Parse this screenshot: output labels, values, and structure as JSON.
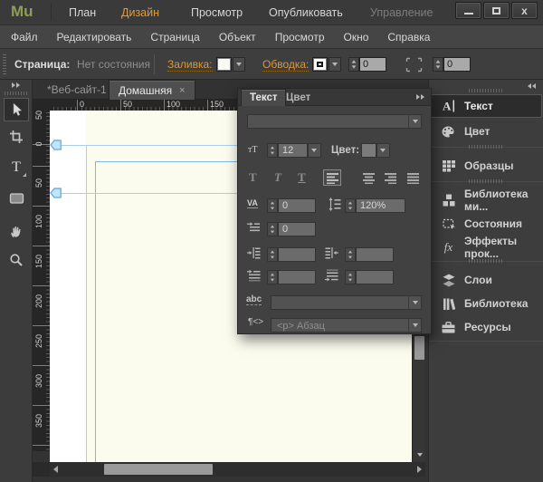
{
  "titlebar": {
    "logo": "Mu",
    "nav": [
      {
        "label": "План",
        "state": "normal"
      },
      {
        "label": "Дизайн",
        "state": "active"
      },
      {
        "label": "Просмотр",
        "state": "normal"
      },
      {
        "label": "Опубликовать",
        "state": "normal"
      },
      {
        "label": "Управление",
        "state": "disabled"
      }
    ],
    "close_glyph": "x"
  },
  "menubar": {
    "items": [
      "Файл",
      "Редактировать",
      "Страница",
      "Объект",
      "Просмотр",
      "Окно",
      "Справка"
    ]
  },
  "controlbar": {
    "page_label": "Страница:",
    "page_state": "Нет состояния",
    "fill_label": "Заливка:",
    "stroke_label": "Обводка:",
    "stroke_size": "0",
    "corner_radius": "0"
  },
  "tabbar": {
    "tabs": [
      {
        "label": "*Веб-сайт-1",
        "close": "×",
        "active": false
      },
      {
        "label": "Домашняя",
        "close": "×",
        "active": true
      }
    ]
  },
  "rulers": {
    "horizontal": [
      "0",
      "50",
      "100",
      "150"
    ],
    "vertical": [
      "50",
      "0",
      "50",
      "100",
      "150",
      "200",
      "250",
      "300",
      "350"
    ]
  },
  "text_panel": {
    "tabs": [
      {
        "label": "Текст",
        "active": true
      },
      {
        "label": "Цвет",
        "active": false
      }
    ],
    "size_icon": "тТ",
    "font_size": "12",
    "color_label": "Цвет:",
    "bold_glyph": "T",
    "italic_glyph": "T",
    "underline_glyph": "T",
    "kerning_glyph": "VA",
    "kerning_value": "0",
    "leading_value": "120%",
    "first_indent_value": "0",
    "left_indent_value": "",
    "right_indent_value": "",
    "space_above_value": "",
    "space_below_value": "",
    "link_style_glyph": "abc",
    "para_tag_glyph": "¶<>",
    "para_style_value": "<p> Абзац"
  },
  "sidebar": {
    "items": [
      {
        "label": "Текст",
        "icon": "text-icon",
        "active": true
      },
      {
        "label": "Цвет",
        "icon": "color-icon",
        "active": false
      },
      {
        "label": "Образцы",
        "icon": "swatches-icon",
        "active": false
      },
      {
        "label": "Библиотека ми...",
        "icon": "widgets-library-icon",
        "active": false
      },
      {
        "label": "Состояния",
        "icon": "states-icon",
        "active": false
      },
      {
        "label": "Эффекты прок...",
        "icon": "scroll-effects-icon",
        "active": false,
        "glyph": "fx"
      },
      {
        "label": "Слои",
        "icon": "layers-icon",
        "active": false
      },
      {
        "label": "Библиотека",
        "icon": "library-icon",
        "active": false
      },
      {
        "label": "Ресурсы",
        "icon": "assets-icon",
        "active": false
      }
    ]
  },
  "colors": {
    "accent_orange": "#dd9733",
    "logo_olive": "#8e9e51",
    "guide_blue": "#7db8e2",
    "canvas_cream": "#fbfbee",
    "chrome_dark": "#3d3d3d"
  }
}
